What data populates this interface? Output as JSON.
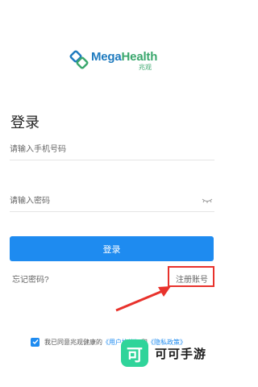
{
  "brand": {
    "name_part1": "Mega",
    "name_part2": "Health",
    "subtitle": "兆观"
  },
  "title": "登录",
  "form": {
    "phone_placeholder": "请输入手机号码",
    "password_placeholder": "请输入密码"
  },
  "login_button": "登录",
  "forgot_password": "忘记密码?",
  "register_account": "注册账号",
  "agreement": {
    "prefix": "我已同意兆观健康的",
    "user_agreement": "《用户协议》",
    "and": "和",
    "privacy_policy": "《隐私政策》"
  },
  "watermark": {
    "icon_char": "可",
    "text": "可可手游"
  },
  "colors": {
    "primary": "#1e8bf0",
    "highlight": "#e8322c",
    "logo_blue": "#1f7bbf",
    "logo_green": "#3aa76d"
  }
}
